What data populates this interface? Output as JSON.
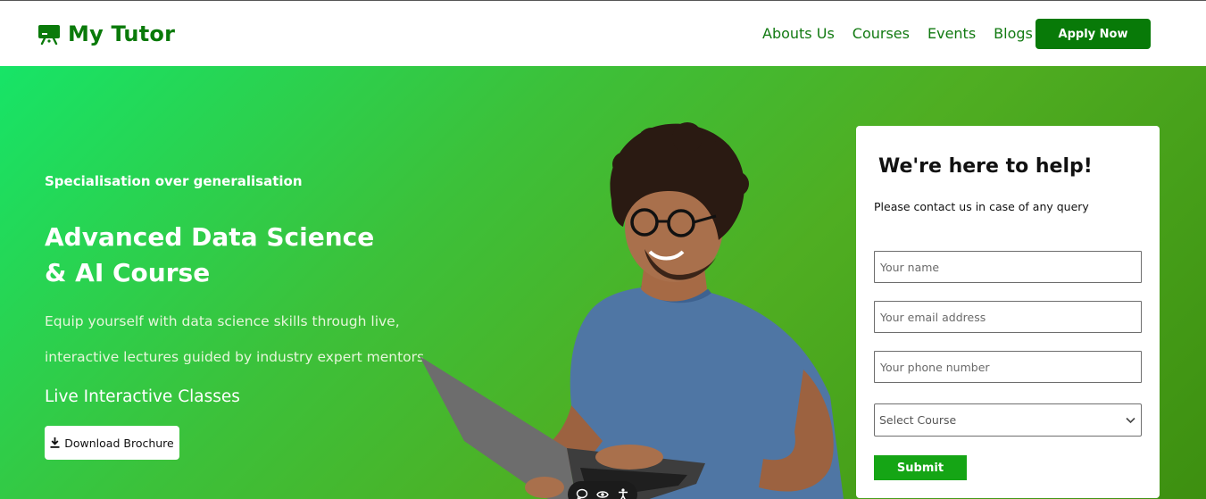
{
  "brand": {
    "name": "My Tutor",
    "icon": "presentation-board-icon"
  },
  "nav": {
    "links": [
      "Abouts Us",
      "Courses",
      "Events",
      "Blogs"
    ],
    "apply_label": "Apply Now"
  },
  "hero": {
    "tagline": "Specialisation over generalisation",
    "title_line1": "Advanced Data Science",
    "title_line2": "& AI Course",
    "desc_line1": "Equip yourself with data science skills through live,",
    "desc_line2": "interactive lectures guided by industry expert mentors",
    "feature": "Live Interactive Classes",
    "brochure_label": "Download Brochure"
  },
  "form": {
    "title": "We're here to help!",
    "subtitle": "Please contact us in case of any query",
    "name_placeholder": "Your name",
    "email_placeholder": "Your email address",
    "phone_placeholder": "Your phone number",
    "course_select": "Select Course",
    "submit_label": "Submit"
  },
  "accessibility_widget": {
    "icons": [
      "chat-icon",
      "eye-icon",
      "accessibility-person-icon"
    ]
  },
  "colors": {
    "brand_green": "#0a7a0a",
    "button_green": "#087a08",
    "submit_green": "#15a515",
    "hero_gradient_start": "#17e467",
    "hero_gradient_end": "#3d8f10"
  }
}
